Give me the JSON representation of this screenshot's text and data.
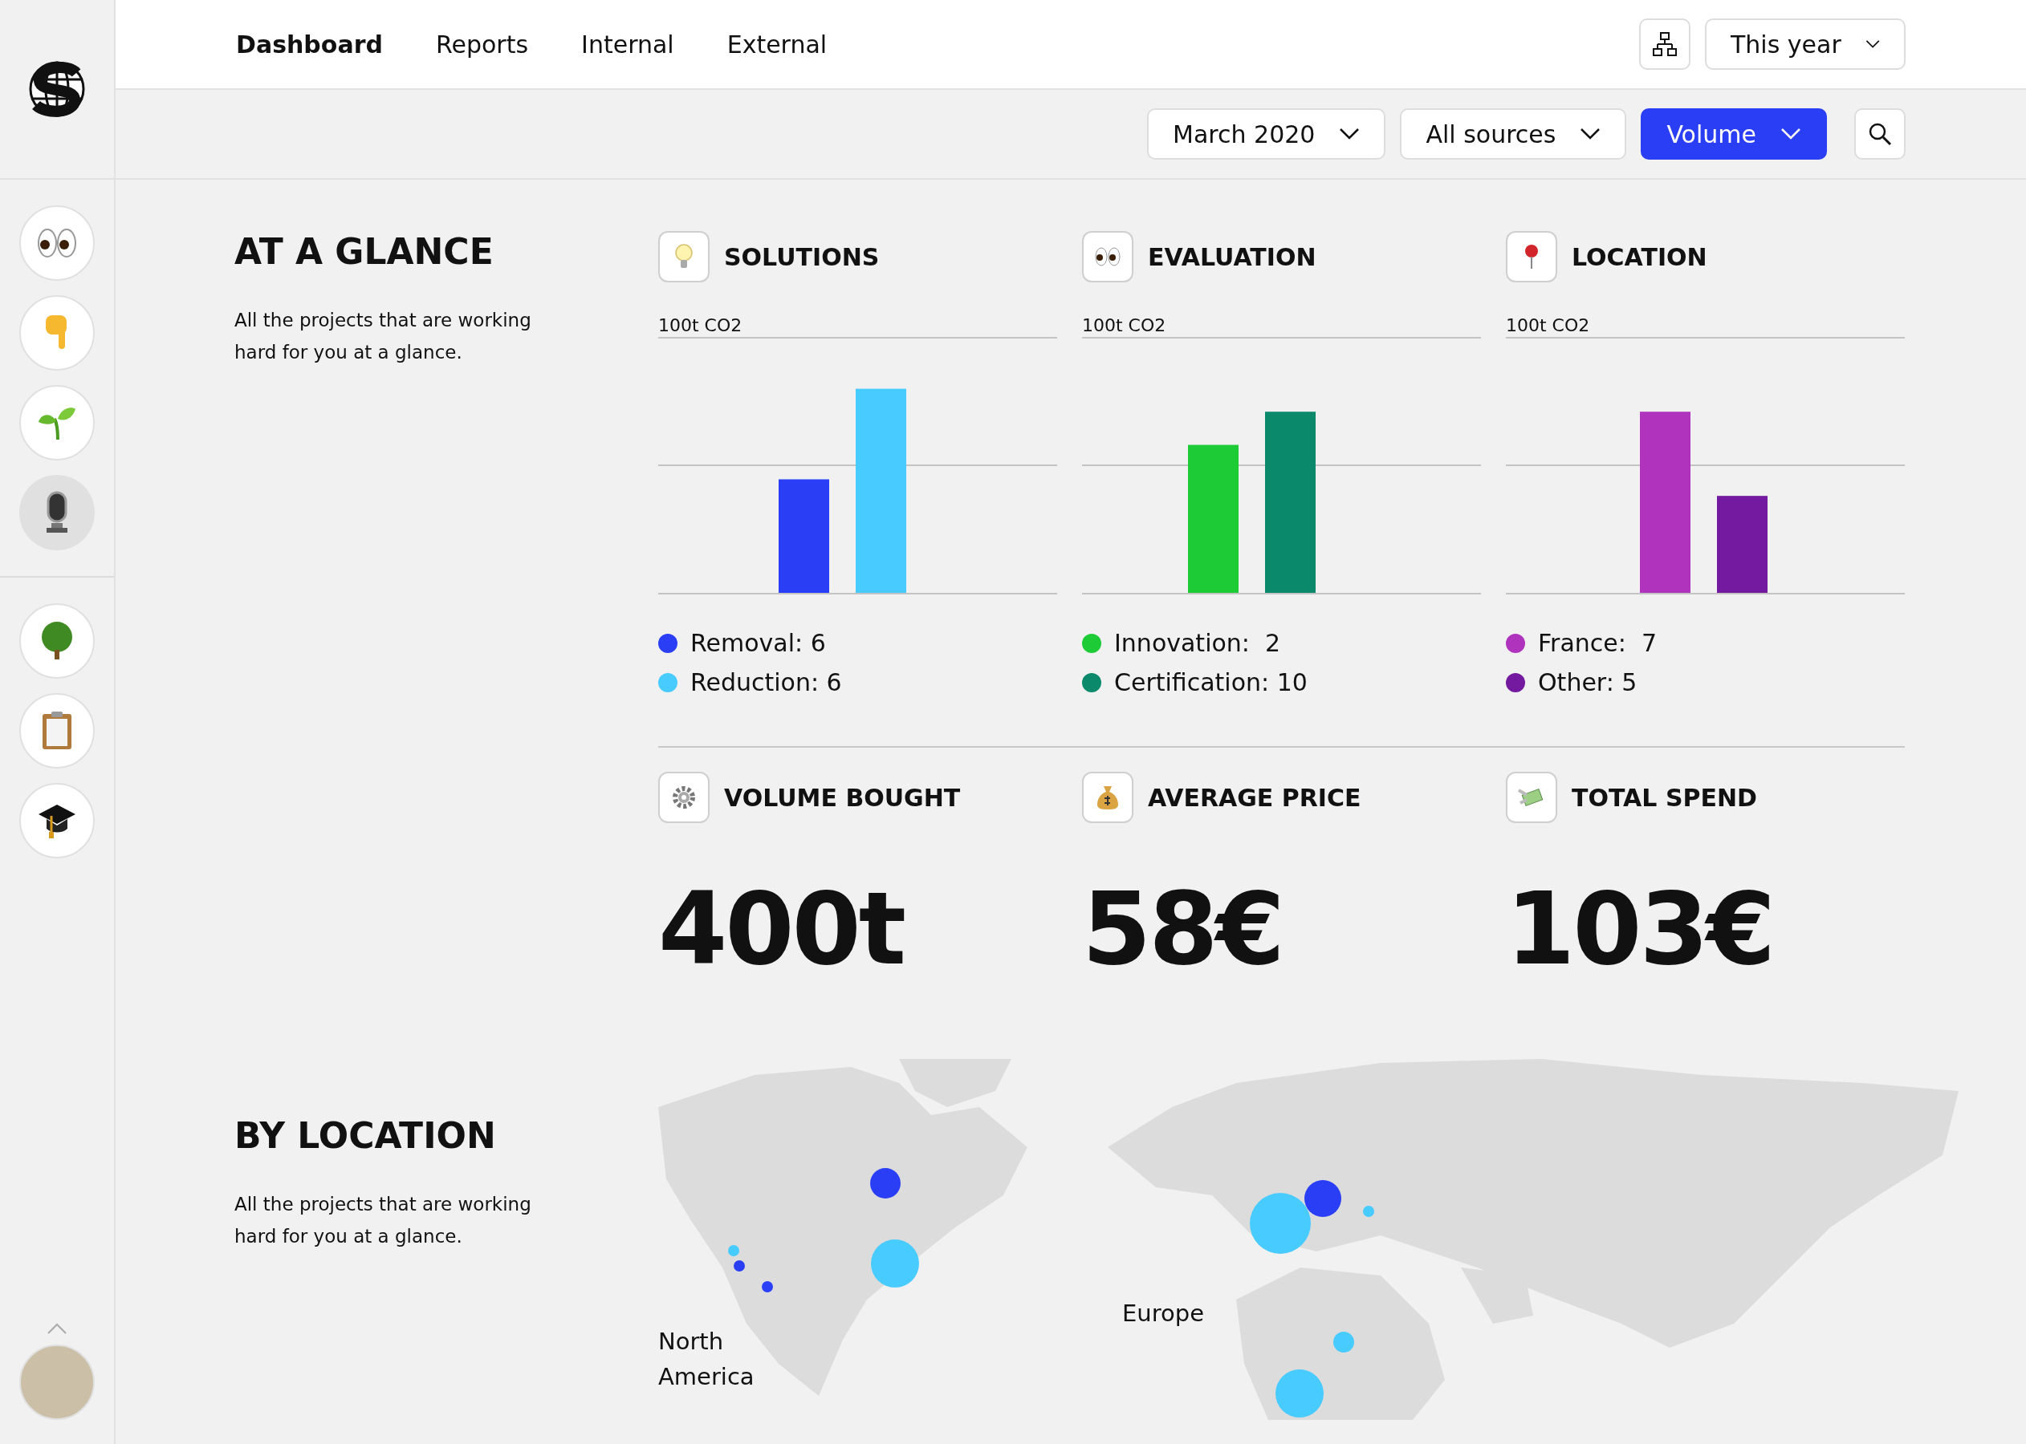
{
  "nav": {
    "tabs": [
      {
        "label": "Dashboard",
        "selected": true
      },
      {
        "label": "Reports",
        "selected": false
      },
      {
        "label": "Internal",
        "selected": false
      },
      {
        "label": "External",
        "selected": false
      }
    ],
    "period": "This year"
  },
  "filters": [
    {
      "value": "March 2020",
      "primary": false
    },
    {
      "value": "All sources",
      "primary": false
    },
    {
      "value": "Volume",
      "primary": true
    }
  ],
  "sidebar": {
    "items": [
      {
        "selected": false
      },
      {
        "selected": false
      },
      {
        "selected": false
      },
      {
        "selected": true
      }
    ],
    "lower_items": [
      {
        "selected": false
      },
      {
        "selected": false
      },
      {
        "selected": false
      }
    ]
  },
  "glance": {
    "title": "AT A GLANCE",
    "description": "All the projects that are working hard for you at a glance.",
    "cards": [
      {
        "title": "SOLUTIONS",
        "axis_label": "100t CO2",
        "legend": [
          {
            "label": "Removal: 6",
            "color": "#2a3ff5"
          },
          {
            "label": "Reduction: 6",
            "color": "#48cbff"
          }
        ]
      },
      {
        "title": "EVALUATION",
        "axis_label": "100t CO2",
        "legend": [
          {
            "label": "Innovation:  2",
            "color": "#1ccb36"
          },
          {
            "label": "Certification: 10",
            "color": "#0a8a6b"
          }
        ]
      },
      {
        "title": "LOCATION",
        "axis_label": "100t CO2",
        "legend": [
          {
            "label": "France:  7",
            "color": "#b033bd"
          },
          {
            "label": "Other: 5",
            "color": "#731aa0"
          }
        ]
      }
    ]
  },
  "metrics": [
    {
      "title": "VOLUME BOUGHT",
      "value": "400t"
    },
    {
      "title": "AVERAGE PRICE",
      "value": "58€"
    },
    {
      "title": "TOTAL SPEND",
      "value": "103€"
    }
  ],
  "location": {
    "title": "BY LOCATION",
    "description": "All the projects that are working hard for you at a glance.",
    "map_labels": [
      "North America",
      "Europe"
    ]
  }
}
